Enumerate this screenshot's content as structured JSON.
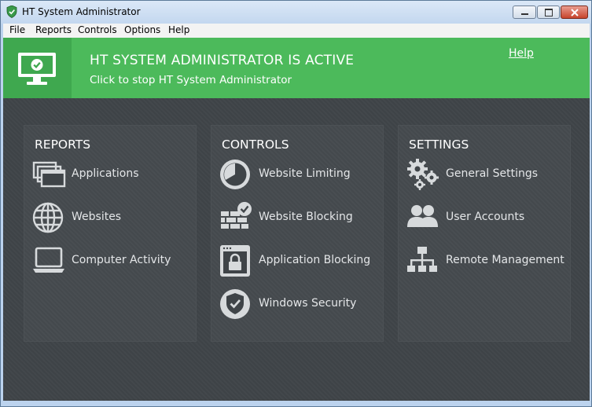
{
  "window": {
    "title": "HT System Administrator"
  },
  "menu": {
    "items": [
      "File",
      "Reports",
      "Controls",
      "Options",
      "Help"
    ]
  },
  "banner": {
    "title": "HT SYSTEM ADMINISTRATOR IS ACTIVE",
    "subtitle": "Click to stop HT System Administrator",
    "help": "Help",
    "accent_color": "#4cba5b"
  },
  "reports": {
    "title": "REPORTS",
    "items": [
      {
        "label": "Applications",
        "icon": "applications-icon"
      },
      {
        "label": "Websites",
        "icon": "globe-icon"
      },
      {
        "label": "Computer Activity",
        "icon": "laptop-icon"
      }
    ]
  },
  "controls": {
    "title": "CONTROLS",
    "items": [
      {
        "label": "Website Limiting",
        "icon": "clock-icon"
      },
      {
        "label": "Website Blocking",
        "icon": "brick-wall-icon"
      },
      {
        "label": "Application Blocking",
        "icon": "lock-window-icon"
      },
      {
        "label": "Windows Security",
        "icon": "shield-check-icon"
      }
    ]
  },
  "settings": {
    "title": "SETTINGS",
    "items": [
      {
        "label": "General Settings",
        "icon": "gears-icon"
      },
      {
        "label": "User Accounts",
        "icon": "users-icon"
      },
      {
        "label": "Remote Management",
        "icon": "network-icon"
      }
    ]
  }
}
